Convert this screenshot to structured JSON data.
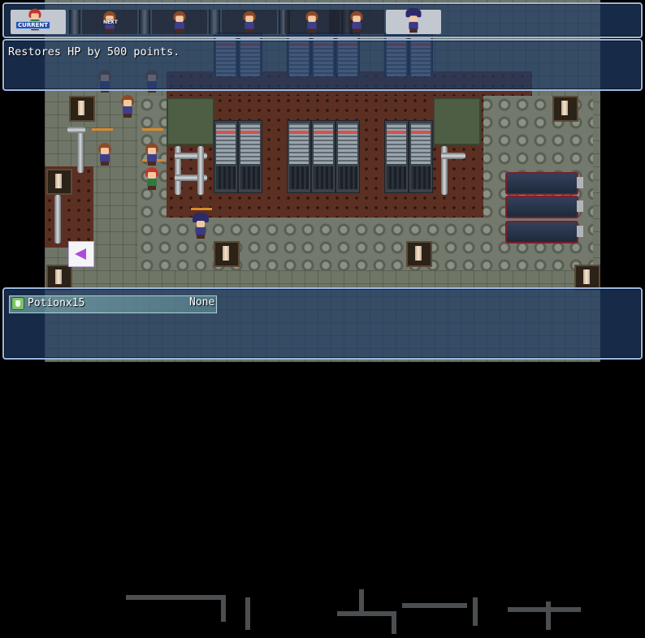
{
  "turn_order": {
    "current_label": "CURRENT",
    "next_label": "NEXT",
    "slots": [
      {
        "char": "red-haired-hero",
        "active": true
      },
      {
        "char": "brown-haired-girl",
        "active": false
      },
      {
        "char": "brown-haired-girl",
        "active": false
      },
      {
        "char": "brown-haired-girl",
        "active": false
      },
      {
        "char": "brown-haired-girl",
        "active": false
      },
      {
        "char": "brown-haired-girl",
        "active": false
      },
      {
        "char": "witch",
        "active": true
      }
    ]
  },
  "help": {
    "text": "Restores HP by 500 points."
  },
  "item_list": {
    "items": [
      {
        "icon": "potion-icon",
        "name": "Potionx15",
        "note": "None",
        "selected": true
      }
    ]
  },
  "colors": {
    "window_border": "#9bb7e0",
    "window_fill": "#203a64",
    "selection": "#96c8c8",
    "cursor_arrow": "#b04bdb"
  }
}
